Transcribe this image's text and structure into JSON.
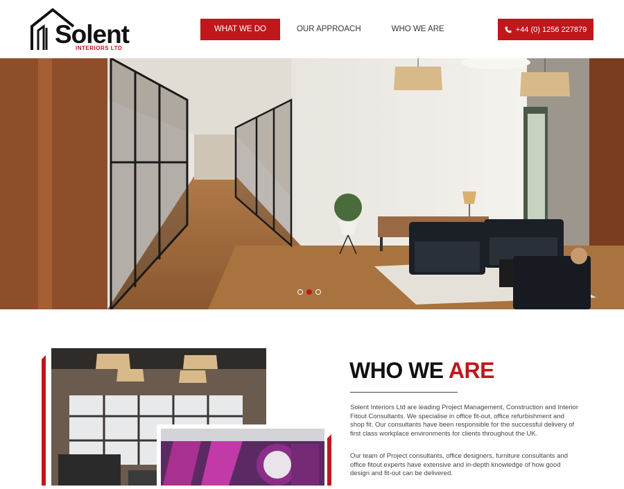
{
  "brand": {
    "name": "Solent",
    "tagline": "INTERIORS LTD",
    "accent_color": "#c0171b"
  },
  "nav": {
    "items": [
      {
        "label": "WHAT WE DO",
        "active": true
      },
      {
        "label": "OUR APPROACH",
        "active": false
      },
      {
        "label": "WHO WE ARE",
        "active": false
      }
    ]
  },
  "contact": {
    "phone_label": "+44 (0) 1256 227879",
    "icon": "phone-icon"
  },
  "slider": {
    "slide_count": 3,
    "active_index": 1
  },
  "who": {
    "title_plain": "WHO WE",
    "title_accent": "ARE",
    "paragraph_1": "Solent Interiors Ltd are leading Project Management, Construction and Interior Fitout Consultants. We specialise in office fit-out, office refurbishment and shop fit. Our consultants have been responsible for the successful delivery of first class workplace environments for clients throughout the UK.",
    "paragraph_2": "Our team of Project consultants, office designers, furniture consultants and office fitout experts have extensive and in-depth knowledge of how good design and fit-out can be delivered."
  }
}
